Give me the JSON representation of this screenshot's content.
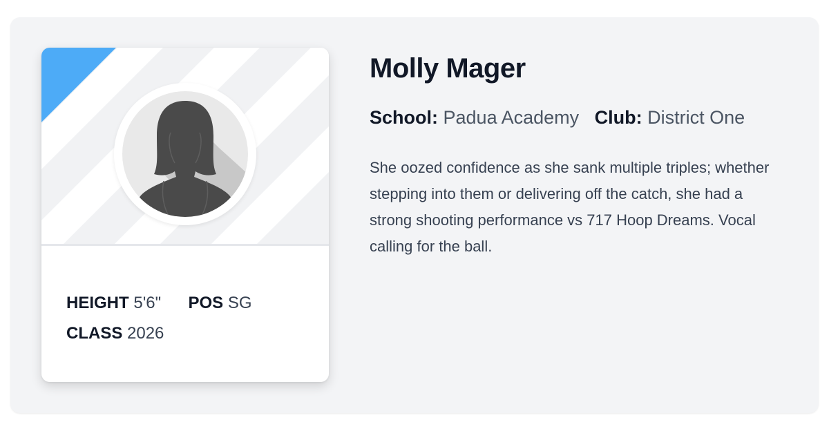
{
  "player": {
    "name": "Molly Mager",
    "school_label": "School:",
    "school": "Padua Academy",
    "club_label": "Club:",
    "club": "District One",
    "bio": "She oozed confidence as she sank multiple triples; whether stepping into them or delivering off the catch, she had a strong shooting performance vs 717 Hoop Dreams. Vocal calling for the ball."
  },
  "stats": {
    "height_label": "HEIGHT",
    "height": "5'6\"",
    "pos_label": "POS",
    "pos": "SG",
    "class_label": "CLASS",
    "class": "2026"
  },
  "colors": {
    "accent": "#4dabf7",
    "panel_bg": "#f3f4f6",
    "silhouette": "#4a4a4a"
  },
  "icons": {
    "avatar": "female-silhouette-icon"
  }
}
